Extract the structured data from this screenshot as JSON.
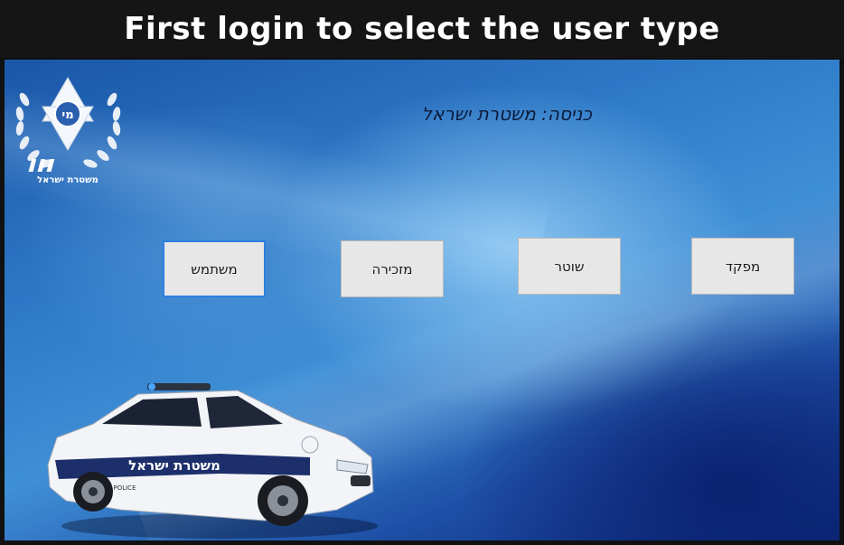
{
  "banner": {
    "title": "First login to select the user type"
  },
  "logo": {
    "caption": "משטרת ישראל",
    "emblem_text": "מי"
  },
  "header": {
    "welcome": "כניסה: משטרת ישראל"
  },
  "roles": [
    {
      "label": "משתמש",
      "focused": true
    },
    {
      "label": "מזכירה",
      "focused": false
    },
    {
      "label": "שוטר",
      "focused": false
    },
    {
      "label": "מפקד",
      "focused": false
    }
  ],
  "car": {
    "livery_text": "משטרת ישראל",
    "police_text": "POLICE"
  },
  "colors": {
    "banner_bg": "#151515",
    "focus_border": "#2f7fe0",
    "button_bg": "#e7e7e7",
    "police_blue": "#1d2f6b"
  }
}
